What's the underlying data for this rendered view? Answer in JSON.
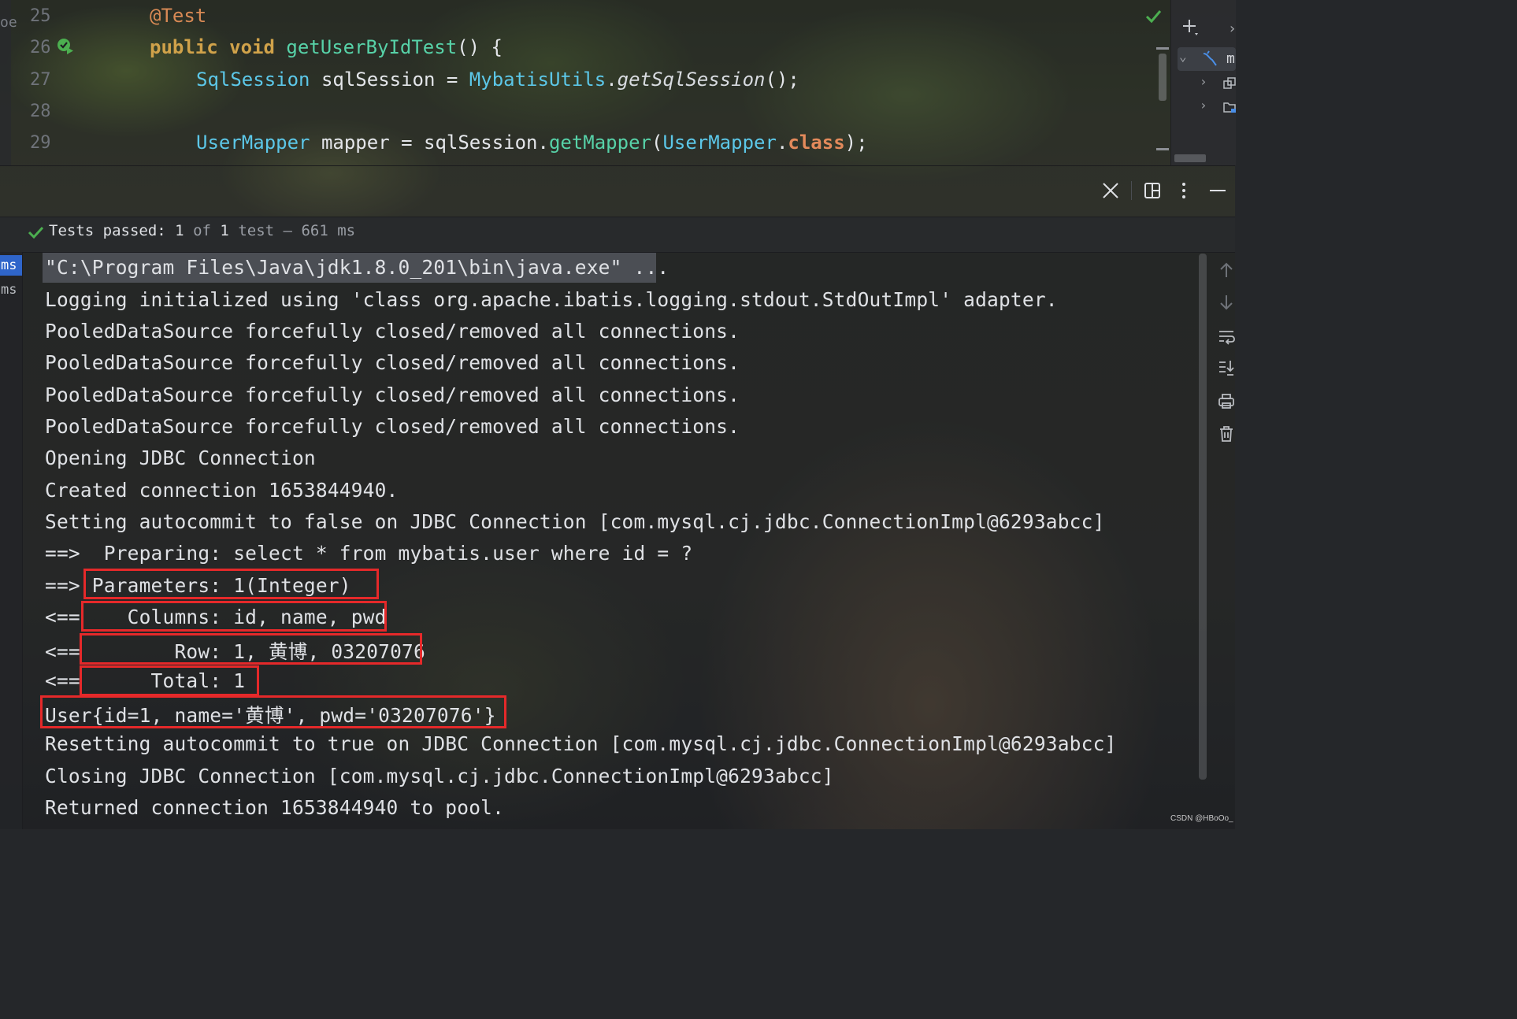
{
  "editor": {
    "line_numbers": [
      "25",
      "26",
      "27",
      "28",
      "29"
    ],
    "gutter_cut_text": "oe",
    "line25": {
      "annotation": "@Test"
    },
    "line26": {
      "kw1": "public",
      "kw2": "void",
      "method": "getUserByIdTest",
      "rest": "() {"
    },
    "line27": {
      "type": "SqlSession",
      "var": " sqlSession = ",
      "cls": "MybatisUtils",
      "dot": ".",
      "call": "getSqlSession",
      "rest": "();"
    },
    "line29": {
      "type": "UserMapper",
      "var": " mapper = sqlSession.",
      "call": "getMapper",
      "paren": "(",
      "cls": "UserMapper",
      "dot": ".",
      "kw": "class",
      "rest": ");"
    }
  },
  "project_tree": {
    "selected_label": "m",
    "icons": [
      "plus-icon",
      "chevron-right-icon",
      "mybatis-icon",
      "module-icon",
      "folder-icon"
    ]
  },
  "tool_window": {
    "actions": [
      "close-icon",
      "layout-icon",
      "more-icon",
      "minimize-icon"
    ]
  },
  "test_status": {
    "label": "Tests passed:",
    "passed": "1",
    "of": "of",
    "total": "1",
    "unit": "test",
    "sep": "–",
    "duration": "661 ms"
  },
  "test_tree": {
    "items": [
      "ms",
      "ms"
    ]
  },
  "console": {
    "lines": [
      "\"C:\\Program Files\\Java\\jdk1.8.0_201\\bin\\java.exe\" ...",
      "Logging initialized using 'class org.apache.ibatis.logging.stdout.StdOutImpl' adapter.",
      "PooledDataSource forcefully closed/removed all connections.",
      "PooledDataSource forcefully closed/removed all connections.",
      "PooledDataSource forcefully closed/removed all connections.",
      "PooledDataSource forcefully closed/removed all connections.",
      "Opening JDBC Connection",
      "Created connection 1653844940.",
      "Setting autocommit to false on JDBC Connection [com.mysql.cj.jdbc.ConnectionImpl@6293abcc]",
      "==>  Preparing: select * from mybatis.user where id = ?",
      "==> Parameters: 1(Integer)",
      "<==    Columns: id, name, pwd",
      "<==        Row: 1, 黄博, 03207076",
      "<==      Total: 1",
      "User{id=1, name='黄博', pwd='03207076'}",
      "Resetting autocommit to true on JDBC Connection [com.mysql.cj.jdbc.ConnectionImpl@6293abcc]",
      "Closing JDBC Connection [com.mysql.cj.jdbc.ConnectionImpl@6293abcc]",
      "Returned connection 1653844940 to pool."
    ]
  },
  "console_tools": [
    "up-arrow-icon",
    "down-arrow-icon",
    "soft-wrap-icon",
    "scroll-to-end-icon",
    "print-icon",
    "trash-icon"
  ],
  "colors": {
    "highlight_box": "#e5292a",
    "pass_green": "#4caf50",
    "selection_blue": "#2f65ca"
  },
  "watermark": "CSDN @HBoOo_"
}
